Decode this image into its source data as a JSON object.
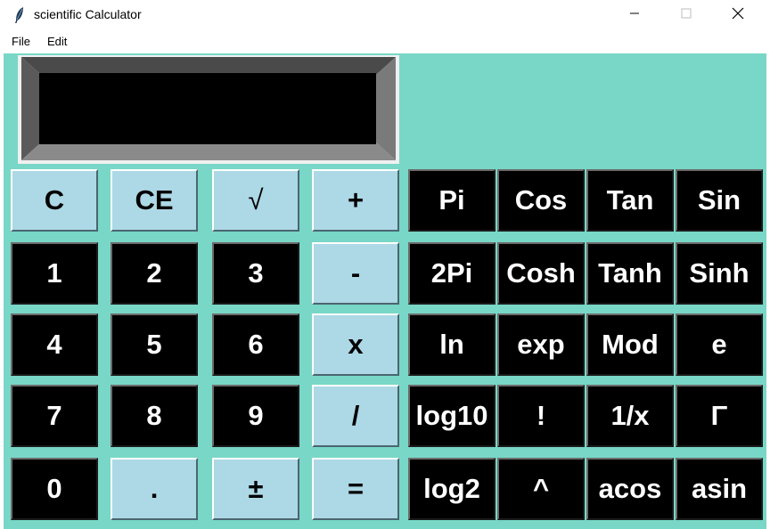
{
  "window": {
    "title": "scientific Calculator"
  },
  "menu": {
    "items": [
      "File",
      "Edit"
    ]
  },
  "display": {
    "value": ""
  },
  "colors": {
    "background": "#78d7c6",
    "light_button": "#add8e6",
    "dark_button": "#000000",
    "display": "#000000"
  },
  "buttons": {
    "row1": [
      "C",
      "CE",
      "√",
      "+"
    ],
    "row2": [
      "1",
      "2",
      "3",
      "-"
    ],
    "row3": [
      "4",
      "5",
      "6",
      "x"
    ],
    "row4": [
      "7",
      "8",
      "9",
      "/"
    ],
    "row5": [
      "0",
      ".",
      "±",
      "="
    ]
  },
  "scientific": {
    "row1": [
      "Pi",
      "Cos",
      "Tan",
      "Sin"
    ],
    "row2": [
      "2Pi",
      "Cosh",
      "Tanh",
      "Sinh"
    ],
    "row3": [
      "ln",
      "exp",
      "Mod",
      "e"
    ],
    "row4": [
      "log10",
      "!",
      "1/x",
      "Γ"
    ],
    "row5": [
      "log2",
      "^",
      "acos",
      "asin"
    ]
  }
}
